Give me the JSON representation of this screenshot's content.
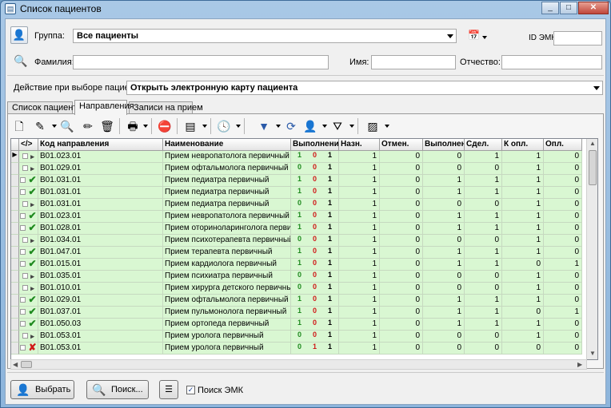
{
  "window": {
    "title": "Список пациентов"
  },
  "filters": {
    "group_label": "Группа:",
    "group_value": "Все пациенты",
    "id_emk_label": "ID ЭМК:",
    "surname_label": "Фамилия:",
    "name_label": "Имя:",
    "patronymic_label": "Отчество:",
    "action_label": "Действие при выборе пациента:",
    "action_value": "Открыть электронную карту пациента"
  },
  "tabs": [
    "Список пациентов",
    "Направления",
    "Записи на прием"
  ],
  "active_tab": 1,
  "toolbar": {
    "icons": [
      "new-document-icon",
      "edit-icon",
      "search-icon",
      "pencil-icon",
      "trash-icon",
      "print-icon",
      "stop-icon",
      "add-list-icon",
      "clock-icon",
      "filter-icon",
      "refresh-icon",
      "doctor-icon",
      "filter-list-icon",
      "settings-panel-icon"
    ]
  },
  "grid": {
    "columns": [
      "",
      "</>",
      "Код направления",
      "Наименование",
      "Выполнение",
      "Назн.",
      "Отмен.",
      "Выполнено",
      "Сдел.",
      "К опл.",
      "Опл."
    ],
    "rows": [
      {
        "status": "arrow",
        "code": "B01.023.01",
        "name": "Прием невропатолога первичный",
        "v": [
          "1",
          "0",
          "1"
        ],
        "vc": [
          "green",
          "red",
          "black"
        ],
        "nazn": "1",
        "otmen": "0",
        "vyp": "0",
        "sdel": "1",
        "kopl": "1",
        "opl": "0",
        "current": true
      },
      {
        "status": "arrow",
        "code": "B01.029.01",
        "name": "Прием офтальмолога первичный",
        "v": [
          "0",
          "0",
          "1"
        ],
        "vc": [
          "green",
          "red",
          "black"
        ],
        "nazn": "1",
        "otmen": "0",
        "vyp": "0",
        "sdel": "0",
        "kopl": "1",
        "opl": "0"
      },
      {
        "status": "check",
        "code": "B01.031.01",
        "name": "Прием педиатра первичный",
        "v": [
          "1",
          "0",
          "1"
        ],
        "vc": [
          "green",
          "red",
          "black"
        ],
        "nazn": "1",
        "otmen": "0",
        "vyp": "1",
        "sdel": "1",
        "kopl": "1",
        "opl": "0"
      },
      {
        "status": "check",
        "code": "B01.031.01",
        "name": "Прием педиатра первичный",
        "v": [
          "1",
          "0",
          "1"
        ],
        "vc": [
          "green",
          "red",
          "black"
        ],
        "nazn": "1",
        "otmen": "0",
        "vyp": "1",
        "sdel": "1",
        "kopl": "1",
        "opl": "0"
      },
      {
        "status": "arrow",
        "code": "B01.031.01",
        "name": "Прием педиатра первичный",
        "v": [
          "0",
          "0",
          "1"
        ],
        "vc": [
          "green",
          "red",
          "black"
        ],
        "nazn": "1",
        "otmen": "0",
        "vyp": "0",
        "sdel": "0",
        "kopl": "1",
        "opl": "0"
      },
      {
        "status": "check",
        "code": "B01.023.01",
        "name": "Прием невропатолога первичный",
        "v": [
          "1",
          "0",
          "1"
        ],
        "vc": [
          "green",
          "red",
          "black"
        ],
        "nazn": "1",
        "otmen": "0",
        "vyp": "1",
        "sdel": "1",
        "kopl": "1",
        "opl": "0"
      },
      {
        "status": "check",
        "code": "B01.028.01",
        "name": "Прием оториноларинголога первичный",
        "v": [
          "1",
          "0",
          "1"
        ],
        "vc": [
          "green",
          "red",
          "black"
        ],
        "nazn": "1",
        "otmen": "0",
        "vyp": "1",
        "sdel": "1",
        "kopl": "1",
        "opl": "0"
      },
      {
        "status": "arrow",
        "code": "B01.034.01",
        "name": "Прием психотерапевта первичный",
        "v": [
          "0",
          "0",
          "1"
        ],
        "vc": [
          "green",
          "red",
          "black"
        ],
        "nazn": "1",
        "otmen": "0",
        "vyp": "0",
        "sdel": "0",
        "kopl": "1",
        "opl": "0"
      },
      {
        "status": "check",
        "code": "B01.047.01",
        "name": "Прием терапевта первичный",
        "v": [
          "1",
          "0",
          "1"
        ],
        "vc": [
          "green",
          "red",
          "black"
        ],
        "nazn": "1",
        "otmen": "0",
        "vyp": "1",
        "sdel": "1",
        "kopl": "1",
        "opl": "0"
      },
      {
        "status": "check",
        "code": "B01.015.01",
        "name": "Прием кардиолога первичный",
        "v": [
          "1",
          "0",
          "1"
        ],
        "vc": [
          "green",
          "red",
          "black"
        ],
        "nazn": "1",
        "otmen": "0",
        "vyp": "1",
        "sdel": "1",
        "kopl": "0",
        "opl": "1"
      },
      {
        "status": "arrow",
        "code": "B01.035.01",
        "name": "Прием психиатра первичный",
        "v": [
          "0",
          "0",
          "1"
        ],
        "vc": [
          "green",
          "red",
          "black"
        ],
        "nazn": "1",
        "otmen": "0",
        "vyp": "0",
        "sdel": "0",
        "kopl": "1",
        "opl": "0"
      },
      {
        "status": "arrow",
        "code": "B01.010.01",
        "name": "Прием хирурга детского первичный",
        "v": [
          "0",
          "0",
          "1"
        ],
        "vc": [
          "green",
          "red",
          "black"
        ],
        "nazn": "1",
        "otmen": "0",
        "vyp": "0",
        "sdel": "0",
        "kopl": "1",
        "opl": "0"
      },
      {
        "status": "check",
        "code": "B01.029.01",
        "name": "Прием офтальмолога первичный",
        "v": [
          "1",
          "0",
          "1"
        ],
        "vc": [
          "green",
          "red",
          "black"
        ],
        "nazn": "1",
        "otmen": "0",
        "vyp": "1",
        "sdel": "1",
        "kopl": "1",
        "opl": "0"
      },
      {
        "status": "check",
        "code": "B01.037.01",
        "name": "Прием пульмонолога первичный",
        "v": [
          "1",
          "0",
          "1"
        ],
        "vc": [
          "green",
          "red",
          "black"
        ],
        "nazn": "1",
        "otmen": "0",
        "vyp": "1",
        "sdel": "1",
        "kopl": "0",
        "opl": "1"
      },
      {
        "status": "check",
        "code": "B01.050.03",
        "name": "Прием ортопеда первичный",
        "v": [
          "1",
          "0",
          "1"
        ],
        "vc": [
          "green",
          "red",
          "black"
        ],
        "nazn": "1",
        "otmen": "0",
        "vyp": "1",
        "sdel": "1",
        "kopl": "1",
        "opl": "0"
      },
      {
        "status": "arrow",
        "code": "B01.053.01",
        "name": "Прием уролога первичный",
        "v": [
          "0",
          "0",
          "1"
        ],
        "vc": [
          "green",
          "red",
          "black"
        ],
        "nazn": "1",
        "otmen": "0",
        "vyp": "0",
        "sdel": "0",
        "kopl": "1",
        "opl": "0"
      },
      {
        "status": "cross",
        "code": "B01.053.01",
        "name": "Прием уролога первичный",
        "v": [
          "0",
          "1",
          "1"
        ],
        "vc": [
          "green",
          "red",
          "black"
        ],
        "nazn": "1",
        "otmen": "0",
        "vyp": "0",
        "sdel": "0",
        "kopl": "0",
        "opl": "0"
      }
    ]
  },
  "footer": {
    "select_label": "Выбрать",
    "search_label": "Поиск...",
    "emk_search_label": "Поиск ЭМК",
    "emk_search_checked": true
  },
  "colors": {
    "row_bg": "#d9f7d2",
    "check": "#1f8a1f",
    "cross": "#d01818"
  }
}
